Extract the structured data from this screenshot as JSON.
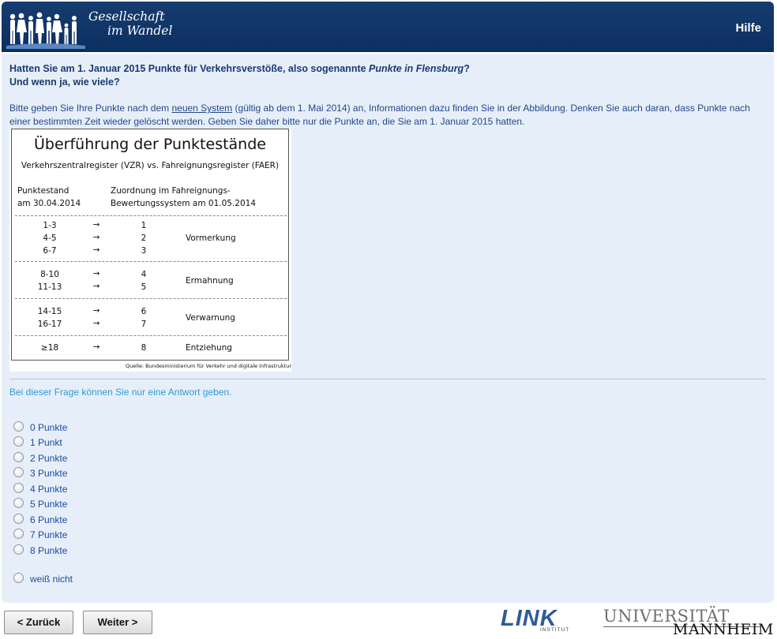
{
  "header": {
    "logo_line1": "Gesellschaft",
    "logo_line2": "im Wandel",
    "help_label": "Hilfe"
  },
  "question": {
    "line1_pre": "Hatten Sie am 1. Januar 2015 Punkte für Verkehrsverstöße, also sogenannte ",
    "line1_em": "Punkte in Flensburg",
    "line1_post": "?",
    "line2": "Und wenn ja, wie viele?"
  },
  "intro": {
    "pre": "Bitte geben Sie Ihre Punkte nach dem ",
    "link": "neuen System",
    "post": " (gültig ab dem 1. Mai 2014) an, Informationen dazu finden Sie in der Abbildung. Denken Sie auch daran, dass Punkte nach einer bestimmten Zeit wieder gelöscht werden. Geben Sie daher bitte nur die Punkte an, die Sie am 1. Januar 2015 hatten."
  },
  "figure": {
    "title": "Überführung der Punktestände",
    "subtitle": "Verkehrszentralregister  (VZR) vs. Fahreignungsregister  (FAER)",
    "col1_line1": "Punktestand",
    "col1_line2": "am 30.04.2014",
    "col2_line1": "Zuordnung im Fahreignungs-",
    "col2_line2": "Bewertungssystem  am 01.05.2014",
    "arrow": "→",
    "rows": [
      {
        "old": "1-3",
        "new": "1"
      },
      {
        "old": "4-5",
        "new": "2"
      },
      {
        "old": "6-7",
        "new": "3"
      },
      {
        "old": "8-10",
        "new": "4"
      },
      {
        "old": "11-13",
        "new": "5"
      },
      {
        "old": "14-15",
        "new": "6"
      },
      {
        "old": "16-17",
        "new": "7"
      },
      {
        "old": "≥18",
        "new": "8"
      }
    ],
    "labels": [
      "Vormerkung",
      "Ermahnung",
      "Verwarnung",
      "Entziehung"
    ],
    "source": "Quelle: Bundesministerium für Verkehr und digitale Infrastruktur"
  },
  "hint": "Bei dieser Frage können Sie nur eine Antwort geben.",
  "options": [
    "0 Punkte",
    "1 Punkt",
    "2 Punkte",
    "3 Punkte",
    "4 Punkte",
    "5 Punkte",
    "6 Punkte",
    "7 Punkte",
    "8 Punkte",
    "weiß nicht"
  ],
  "nav": {
    "back_label": "< Zurück",
    "next_label": "Weiter >"
  },
  "footer": {
    "link_logo": "LINK",
    "link_sub": "INSTITUT",
    "uni_line1": "UNIVERSITÄT",
    "uni_line2": "MANNHEIM"
  }
}
